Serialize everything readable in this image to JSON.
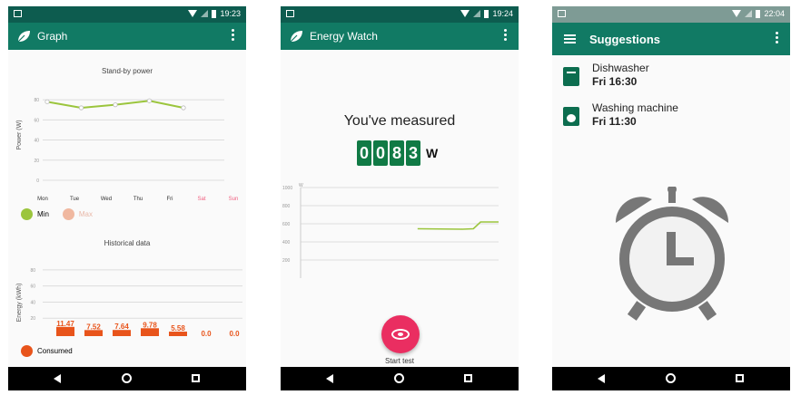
{
  "colors": {
    "status_bar": "#0d5c4f",
    "app_bar": "#117a64",
    "min_series": "#9bc53d",
    "max_series": "#f0b8a0",
    "consumed": "#e8541b",
    "counter_digit": "#107a45",
    "fab": "#ea2e61",
    "clock": "#777777"
  },
  "screen1": {
    "time": "19:23",
    "title": "Graph",
    "icons": {
      "leaf": "leaf-icon",
      "menu": "more-vert-icon"
    },
    "legend_min": "Min",
    "legend_max": "Max",
    "legend_consumed": "Consumed"
  },
  "screen2": {
    "time": "19:24",
    "title": "Energy Watch",
    "measured_label": "You've measured",
    "digits": [
      "0",
      "0",
      "8",
      "3"
    ],
    "unit": "W",
    "start_label": "Start test",
    "icons": {
      "leaf": "leaf-icon",
      "menu": "more-vert-icon",
      "fab": "eye-icon"
    }
  },
  "screen3": {
    "time": "22:04",
    "title": "Suggestions",
    "items": [
      {
        "name": "Dishwasher",
        "time": "Fri 16:30",
        "icon": "dishwasher-icon"
      },
      {
        "name": "Washing machine",
        "time": "Fri 11:30",
        "icon": "washing-machine-icon"
      }
    ],
    "icons": {
      "menu": "hamburger-icon",
      "more": "more-vert-icon",
      "illustration": "alarm-clock-icon"
    }
  },
  "chart_data": [
    {
      "type": "line",
      "title": "Stand-by power",
      "ylabel": "Power (W)",
      "categories": [
        "Mon",
        "Tue",
        "Wed",
        "Thu",
        "Fri",
        "Sat",
        "Sun"
      ],
      "yticks": [
        "80",
        "60",
        "40",
        "20",
        "0"
      ],
      "ylim": [
        0,
        90
      ],
      "series": [
        {
          "name": "Min",
          "values": [
            78,
            72,
            75,
            79,
            72,
            null,
            null
          ]
        }
      ],
      "grid": true
    },
    {
      "type": "bar",
      "title": "Historical data",
      "ylabel": "Energy (kWh)",
      "categories": [
        "Mon",
        "Tue",
        "Wed",
        "Thu",
        "Fri",
        "Sat",
        "Sun"
      ],
      "yticks": [
        "80",
        "60",
        "40",
        "20"
      ],
      "ylim": [
        0,
        90
      ],
      "series": [
        {
          "name": "Consumed",
          "values": [
            11.47,
            7.52,
            7.64,
            9.78,
            5.58,
            0.0,
            0.0
          ],
          "labels": [
            "11.47",
            "7.52",
            "7.64",
            "9.78",
            "5.58",
            "0.0",
            "0.0"
          ]
        }
      ],
      "grid": true
    },
    {
      "type": "line",
      "yunit": "W",
      "yticks": [
        "1000",
        "800",
        "600",
        "400",
        "200"
      ],
      "ylim": [
        0,
        1000
      ],
      "x": [
        0,
        10,
        20,
        30,
        35,
        40,
        45,
        50
      ],
      "series": [
        {
          "values": [
            null,
            null,
            null,
            null,
            550,
            545,
            540,
            545
          ]
        }
      ],
      "xlim": [
        0,
        110
      ],
      "grid": true
    }
  ]
}
